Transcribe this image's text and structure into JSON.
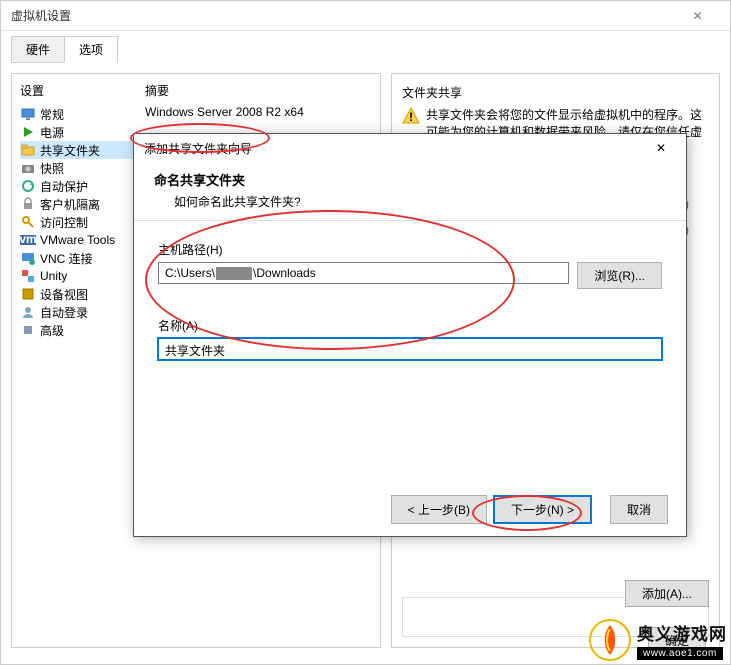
{
  "window": {
    "title": "虚拟机设置",
    "close_glyph": "✕"
  },
  "tabs": {
    "hardware": "硬件",
    "options": "选项"
  },
  "left_panel": {
    "col_settings": "设置",
    "col_summary": "摘要",
    "summary_value": "Windows Server 2008 R2 x64",
    "items": [
      {
        "key": "general",
        "label": "常规",
        "icon": "monitor"
      },
      {
        "key": "power",
        "label": "电源",
        "icon": "play"
      },
      {
        "key": "shared",
        "label": "共享文件夹",
        "icon": "folder-share"
      },
      {
        "key": "snapshot",
        "label": "快照",
        "icon": "camera"
      },
      {
        "key": "autoprotect",
        "label": "自动保护",
        "icon": "shield-refresh"
      },
      {
        "key": "isolation",
        "label": "客户机隔离",
        "icon": "lock"
      },
      {
        "key": "access",
        "label": "访问控制",
        "icon": "key"
      },
      {
        "key": "vmware",
        "label": "VMware Tools",
        "icon": "vm"
      },
      {
        "key": "vnc",
        "label": "VNC 连接",
        "icon": "monitor-net"
      },
      {
        "key": "unity",
        "label": "Unity",
        "icon": "unity"
      },
      {
        "key": "device",
        "label": "设备视图",
        "icon": "device"
      },
      {
        "key": "autologin",
        "label": "自动登录",
        "icon": "person"
      },
      {
        "key": "advanced",
        "label": "高级",
        "icon": "gear"
      }
    ]
  },
  "right_panel": {
    "section_title": "文件夹共享",
    "warning_text": "共享文件夹会将您的文件显示给虚拟机中的程序。这可能为您的计算机和数据带来风险。请仅在您信任虚拟机使用您的数据",
    "hidden1": ")",
    "hidden2": "动器(M)",
    "add_btn": "添加(A)...",
    "ok_btn": "确定"
  },
  "wizard": {
    "title": "添加共享文件夹向导",
    "heading": "命名共享文件夹",
    "subheading": "如何命名此共享文件夹?",
    "host_path_label": "主机路径(H)",
    "host_path_prefix": "C:\\Users\\",
    "host_path_suffix": "\\Downloads",
    "browse_btn": "浏览(R)...",
    "name_label": "名称(A)",
    "name_value": "共享文件夹",
    "back_btn": "< 上一步(B)",
    "next_btn": "下一步(N) >",
    "cancel_btn": "取消",
    "close_glyph": "✕"
  },
  "watermark": {
    "cn": "奥义游戏网",
    "url": "www.aoe1.com"
  }
}
